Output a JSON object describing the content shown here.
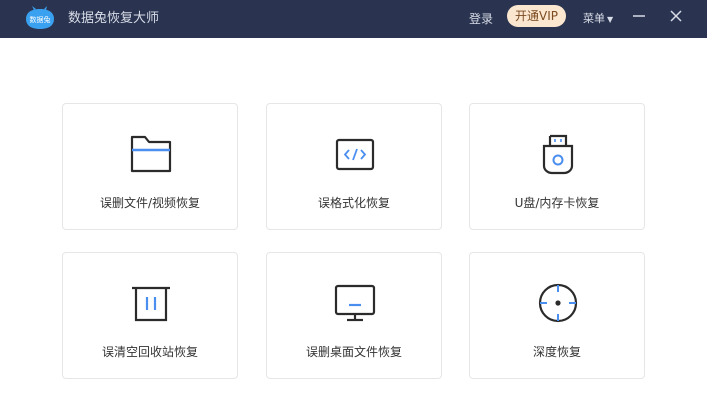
{
  "titlebar": {
    "logo_text": "数据兔",
    "app_title": "数据兔恢复大师",
    "login": "登录",
    "vip_button": "开通VIP",
    "menu": "菜单",
    "menu_caret": "▼"
  },
  "colors": {
    "titlebar_bg": "#2a3450",
    "accent_blue": "#4a8ef0",
    "vip_bg": "#fbe6cf"
  },
  "cards": [
    {
      "label": "误删文件/视频恢复",
      "icon": "folder-icon"
    },
    {
      "label": "误格式化恢复",
      "icon": "code-window-icon"
    },
    {
      "label": "U盘/内存卡恢复",
      "icon": "usb-drive-icon"
    },
    {
      "label": "误清空回收站恢复",
      "icon": "trash-bin-icon"
    },
    {
      "label": "误删桌面文件恢复",
      "icon": "monitor-icon"
    },
    {
      "label": "深度恢复",
      "icon": "crosshair-icon"
    }
  ]
}
